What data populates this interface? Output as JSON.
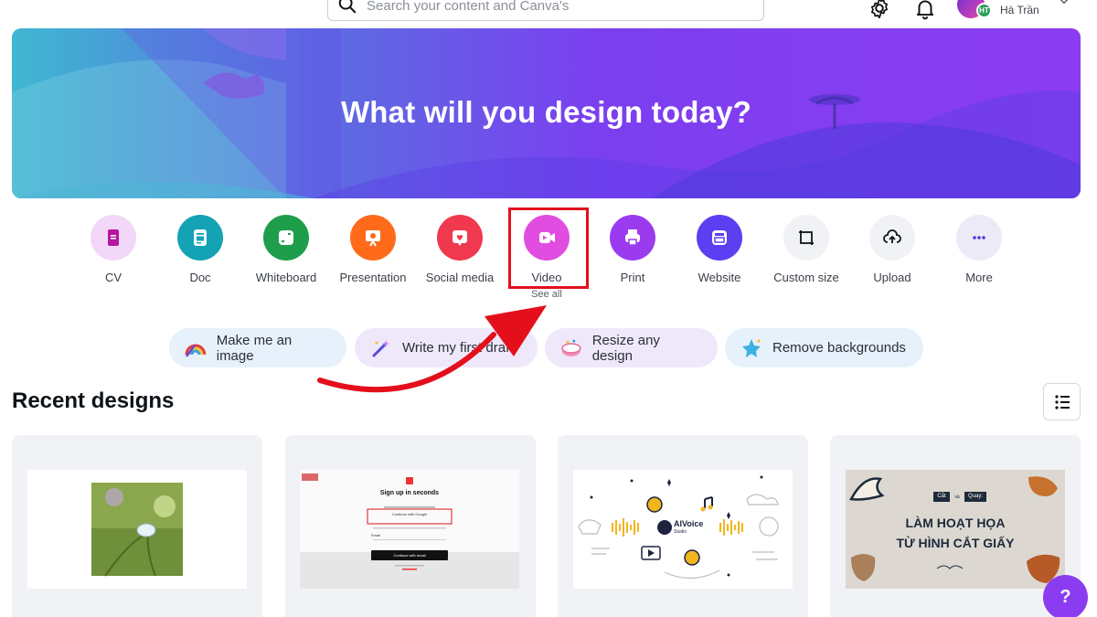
{
  "search": {
    "placeholder": "Search your content and Canva's"
  },
  "user": {
    "name": "Hà Trần",
    "initials": "HT"
  },
  "hero": {
    "title": "What will you design today?"
  },
  "categories": [
    {
      "label": "CV",
      "icon": "cv-icon",
      "color": "#f3d7f9"
    },
    {
      "label": "Doc",
      "icon": "doc-icon",
      "color": "#13a3b5"
    },
    {
      "label": "Whiteboard",
      "icon": "whiteboard-icon",
      "color": "#1e9e4a"
    },
    {
      "label": "Presentation",
      "icon": "presentation-icon",
      "color": "#ff6b1a"
    },
    {
      "label": "Social media",
      "icon": "social-media-icon",
      "color": "#f0394e"
    },
    {
      "label": "Video",
      "icon": "video-icon",
      "color": "#e04de0"
    },
    {
      "label": "Print",
      "icon": "print-icon",
      "color": "#9b3bf0"
    },
    {
      "label": "Website",
      "icon": "website-icon",
      "color": "#5b3ff0"
    },
    {
      "label": "Custom size",
      "icon": "custom-size-icon",
      "color": "#f1f2f5"
    },
    {
      "label": "Upload",
      "icon": "upload-icon",
      "color": "#f1f2f5"
    },
    {
      "label": "More",
      "icon": "more-icon",
      "color": "#eceaf7"
    }
  ],
  "see_all": "See all",
  "pills": [
    {
      "label": "Make me an image",
      "icon": "rainbow-icon"
    },
    {
      "label": "Write my first draft",
      "icon": "magic-wand-icon"
    },
    {
      "label": "Resize any design",
      "icon": "resize-icon"
    },
    {
      "label": "Remove backgrounds",
      "icon": "sparkle-star-icon"
    }
  ],
  "recent": {
    "title": "Recent designs"
  },
  "cards": [
    {
      "name": "water-drop-photo"
    },
    {
      "name": "signup-screenshot",
      "signup_title": "Sign up in seconds",
      "google_btn": "Continue with Google",
      "email_label": "Email",
      "email_btn": "Continue with email"
    },
    {
      "name": "aivoice-studio",
      "brand": "AIVoice",
      "sub": "Studio"
    },
    {
      "name": "paper-cut-animation",
      "tag1": "Cắt",
      "tag_mid": "và",
      "tag2": "Quay:",
      "line1": "LÀM HOẠT HỌA",
      "line2": "TỪ HÌNH CẮT GIẤY"
    }
  ],
  "help": {
    "label": "?"
  },
  "colors": {
    "accent": "#8b3cf0",
    "highlight": "#e3101c"
  }
}
